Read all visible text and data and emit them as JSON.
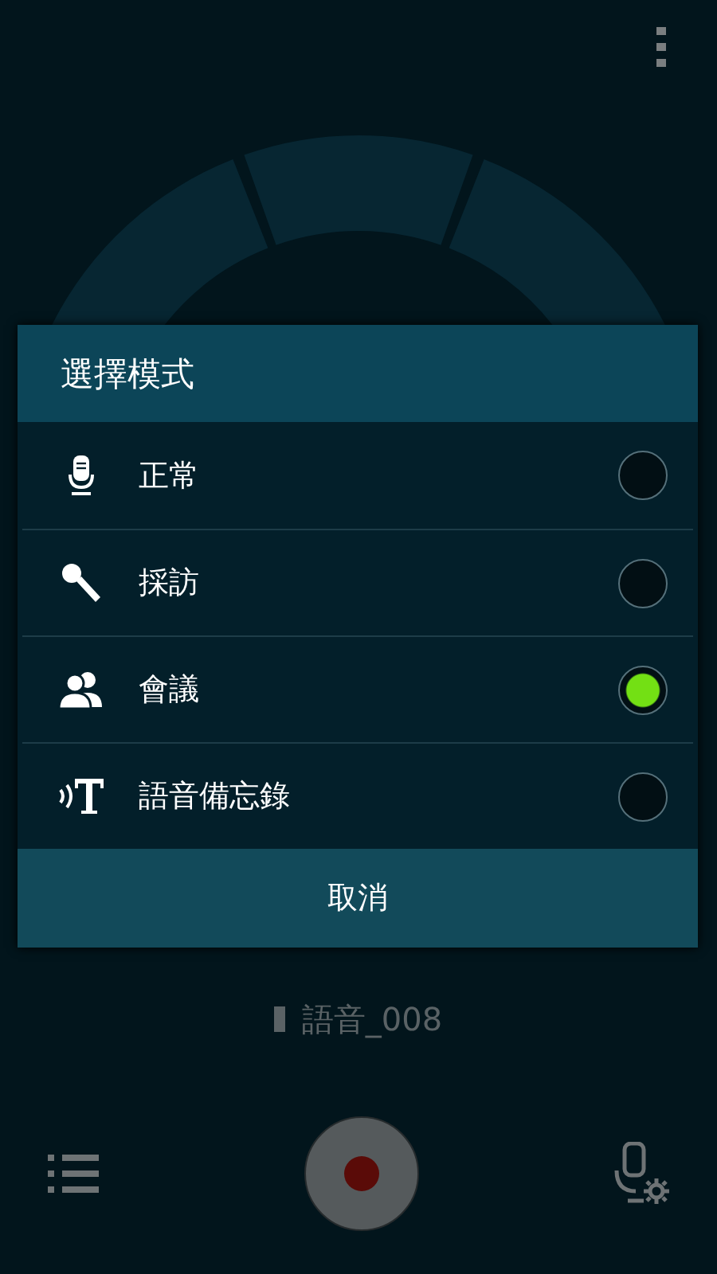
{
  "background": {
    "file_name": "語音_008"
  },
  "dialog": {
    "title": "選擇模式",
    "options": [
      {
        "kind": "normal",
        "label": "正常",
        "selected": false
      },
      {
        "kind": "interview",
        "label": "採訪",
        "selected": false
      },
      {
        "kind": "meeting",
        "label": "會議",
        "selected": true
      },
      {
        "kind": "memo",
        "label": "語音備忘錄",
        "selected": false
      }
    ],
    "cancel": "取消"
  }
}
